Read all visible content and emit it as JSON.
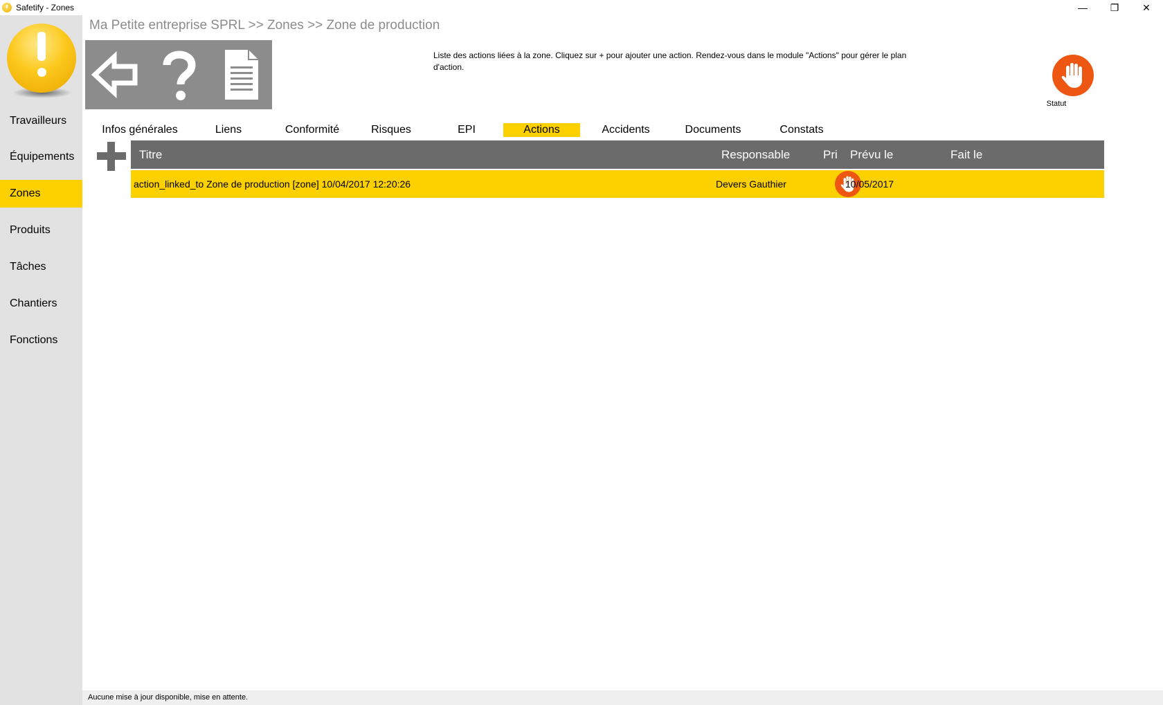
{
  "window": {
    "title": "Safetify - Zones",
    "min_label": "—",
    "max_label": "❐",
    "close_label": "✕"
  },
  "sidebar": {
    "items": [
      {
        "label": "Travailleurs"
      },
      {
        "label": "Équipements"
      },
      {
        "label": "Zones",
        "active": true
      },
      {
        "label": "Produits"
      },
      {
        "label": "Tâches"
      },
      {
        "label": "Chantiers"
      },
      {
        "label": "Fonctions"
      }
    ]
  },
  "breadcrumb": "Ma Petite entreprise SPRL >> Zones >> Zone de production",
  "toolbar": {
    "icons": [
      "back-arrow-icon",
      "help-icon",
      "document-icon"
    ]
  },
  "help_text": "Liste des actions liées à la zone. Cliquez sur + pour ajouter une action. Rendez-vous dans le module \"Actions\" pour gérer le plan d'action.",
  "status": {
    "label": "Statut",
    "icon": "stop-hand-icon",
    "color": "#ee5711"
  },
  "tabs": [
    {
      "label": "Infos générales"
    },
    {
      "label": "Liens"
    },
    {
      "label": "Conformité"
    },
    {
      "label": "Risques"
    },
    {
      "label": "EPI"
    },
    {
      "label": "Actions",
      "active": true
    },
    {
      "label": "Accidents"
    },
    {
      "label": "Documents"
    },
    {
      "label": "Constats"
    }
  ],
  "table": {
    "columns": {
      "title": "Titre",
      "responsible": "Responsable",
      "priority": "Pri",
      "planned": "Prévu le",
      "done": "Fait le"
    },
    "rows": [
      {
        "title": "action_linked_to Zone de production [zone]  10/04/2017 12:20:26",
        "responsible": "Devers Gauthier",
        "priority_icon": "stop-hand-icon",
        "planned": "10/05/2017",
        "done": ""
      }
    ]
  },
  "colors": {
    "accent": "#fdd000",
    "sidebar_bg": "#e2e2e2",
    "header_bg": "#6b6b6b",
    "toolbar_bg": "#8c8c8c",
    "alert": "#ee5711"
  },
  "statusbar": "Aucune mise à jour disponible, mise en attente."
}
